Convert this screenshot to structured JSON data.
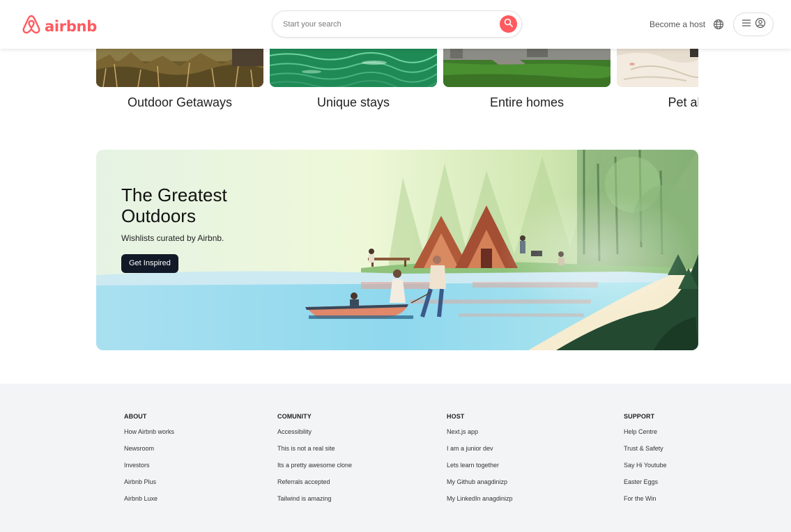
{
  "header": {
    "logo_text": "airbnb",
    "search_placeholder": "Start your search",
    "host_link": "Become a host",
    "brand_color": "#FF5A5F"
  },
  "categories": [
    {
      "label": "Outdoor Getaways"
    },
    {
      "label": "Unique stays"
    },
    {
      "label": "Entire homes"
    },
    {
      "label": "Pet allowed"
    }
  ],
  "banner": {
    "title": "The Greatest Outdoors",
    "subtitle": "Wishlists curated by Airbnb.",
    "button_label": "Get Inspired"
  },
  "footer": {
    "columns": [
      {
        "heading": "ABOUT",
        "links": [
          "How Airbnb works",
          "Newsroom",
          "Investors",
          "Airbnb Plus",
          "Airbnb Luxe"
        ]
      },
      {
        "heading": "COMUNITY",
        "links": [
          "Accessibility",
          "This is not a real site",
          "Its a pretty awesome clone",
          "Referrals accepted",
          "Tailwind is amazing"
        ]
      },
      {
        "heading": "HOST",
        "links": [
          "Next.js app",
          "I am a junior dev",
          "Lets learn together",
          "My Github anagdinizp",
          "My LinkedIn anagdinizp"
        ]
      },
      {
        "heading": "SUPPORT",
        "links": [
          "Help Centre",
          "Trust & Safety",
          "Say Hi Youtube",
          "Easter Eggs",
          "For the Win"
        ]
      }
    ]
  },
  "icons": {
    "logo": "airbnb-logo-icon",
    "search": "search-icon",
    "globe": "globe-icon",
    "menu": "hamburger-icon",
    "user": "user-circle-icon"
  }
}
